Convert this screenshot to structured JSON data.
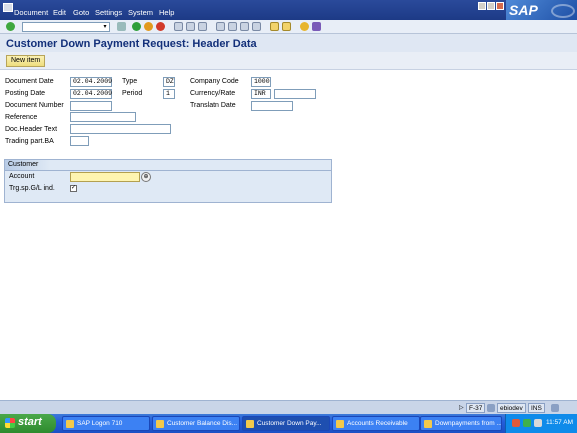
{
  "menu": [
    "Document",
    "Edit",
    "Goto",
    "Settings",
    "System",
    "Help"
  ],
  "logo_text": "SAP",
  "toolbar": {
    "command_value": "",
    "icons": [
      "enter-icon",
      "back-icon",
      "exit-icon",
      "cancel-icon",
      "print-icon",
      "find-icon",
      "find-next-icon",
      "first-page-icon",
      "previous-page-icon",
      "next-page-icon",
      "last-page-icon",
      "create-session-icon",
      "shortcut-icon",
      "help-icon",
      "layout-menu-icon"
    ]
  },
  "title": "Customer Down Payment Request: Header Data",
  "app_toolbar": {
    "new_item_label": "New item"
  },
  "header": {
    "document_date_label": "Document Date",
    "document_date": "02.04.2009",
    "type_label": "Type",
    "type": "DZ",
    "company_code_label": "Company Code",
    "company_code": "1000",
    "posting_date_label": "Posting Date",
    "posting_date": "02.04.2009",
    "period_label": "Period",
    "period": "1",
    "currency_rate_label": "Currency/Rate",
    "currency": "INR",
    "rate": "",
    "document_number_label": "Document Number",
    "document_number": "",
    "translatn_date_label": "Translatn Date",
    "translatn_date": "",
    "reference_label": "Reference",
    "reference": "",
    "doc_header_text_label": "Doc.Header Text",
    "doc_header_text": "",
    "trading_part_label": "Trading part.BA",
    "trading_part": ""
  },
  "customer": {
    "group_title": "Customer",
    "account_label": "Account",
    "account": "",
    "trg_sp_gl_label": "Trg.sp.G/L ind.",
    "trg_sp_gl_checked": true
  },
  "status": {
    "transaction": "F-37",
    "server": "ebiodev",
    "mode": "INS"
  },
  "taskbar": {
    "start_label": "start",
    "tasks": [
      "SAP Logon 710",
      "Customer Balance Dis...",
      "Customer Down Pay...",
      "Accounts Receivable",
      "Downpayments from ..."
    ],
    "clock": "11:57 AM"
  },
  "colors": {
    "title_blue": "#13307a",
    "menubar": "#1d3a86",
    "required_field": "#fff5b0"
  }
}
